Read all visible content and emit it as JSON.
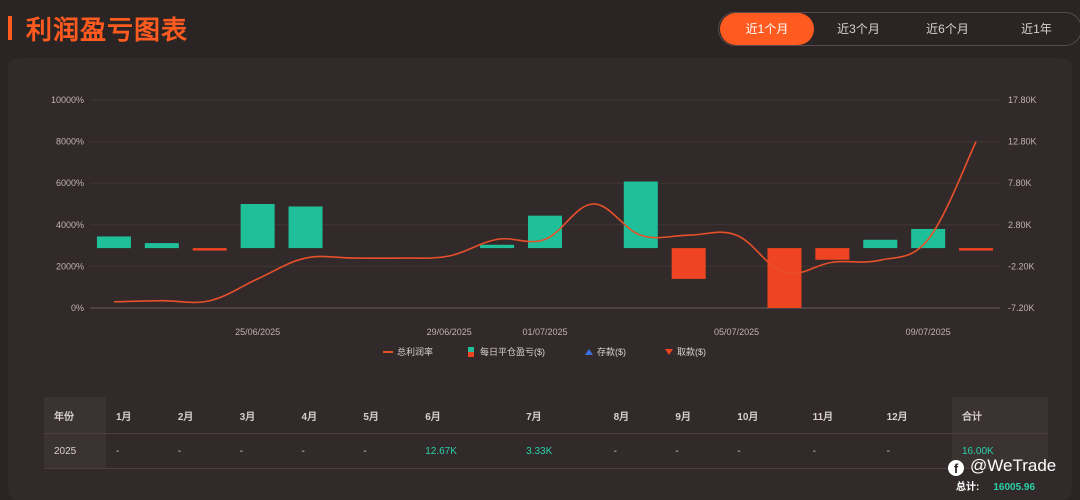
{
  "title": "利润盈亏图表",
  "range_tabs": [
    "近1个月",
    "近3个月",
    "近6个月",
    "近1年"
  ],
  "active_tab": 0,
  "chart_data": {
    "type": "bar+line",
    "x_labels": [
      "25/06/2025",
      "29/06/2025",
      "01/07/2025",
      "05/07/2025",
      "09/07/2025"
    ],
    "x_label_index": [
      3,
      7,
      9,
      13,
      17
    ],
    "dates_count": 19,
    "left_axis": {
      "ticks": [
        "0%",
        "2000%",
        "4000%",
        "6000%",
        "8000%",
        "10000%"
      ],
      "min": 0,
      "max": 10000
    },
    "right_axis": {
      "ticks": [
        "-7.20K",
        "-2.20K",
        "2.80K",
        "7.80K",
        "12.80K",
        "17.80K"
      ],
      "min": -7200,
      "max": 17800
    },
    "daily_pnl": [
      1400,
      600,
      -300,
      5300,
      5000,
      0,
      0,
      0,
      400,
      3900,
      0,
      8000,
      -3700,
      0,
      -7200,
      -1400,
      1000,
      2300,
      -300
    ],
    "total_rate": [
      300,
      350,
      350,
      1400,
      2400,
      2400,
      2400,
      2500,
      3300,
      3300,
      5000,
      3500,
      3500,
      3500,
      1700,
      2200,
      2300,
      3300,
      8000
    ],
    "colors": {
      "profit": "#1fbf99",
      "loss": "#ee4422",
      "line": "#e8502a",
      "deposit": "#3b6fe0",
      "withdraw": "#ee4422"
    },
    "legend": [
      "总利润率",
      "每日平仓盈亏($)",
      "存款($)",
      "取款($)"
    ]
  },
  "table": {
    "header": [
      "年份",
      "1月",
      "2月",
      "3月",
      "4月",
      "5月",
      "6月",
      "7月",
      "8月",
      "9月",
      "10月",
      "11月",
      "12月",
      "合计"
    ],
    "rows": [
      [
        "2025",
        "-",
        "-",
        "-",
        "-",
        "-",
        "12.67K",
        "3.33K",
        "-",
        "-",
        "-",
        "-",
        "-",
        "16.00K"
      ]
    ]
  },
  "watermark": "@WeTrade",
  "grand_total_label": "总计:",
  "grand_total_value": "16005.96"
}
